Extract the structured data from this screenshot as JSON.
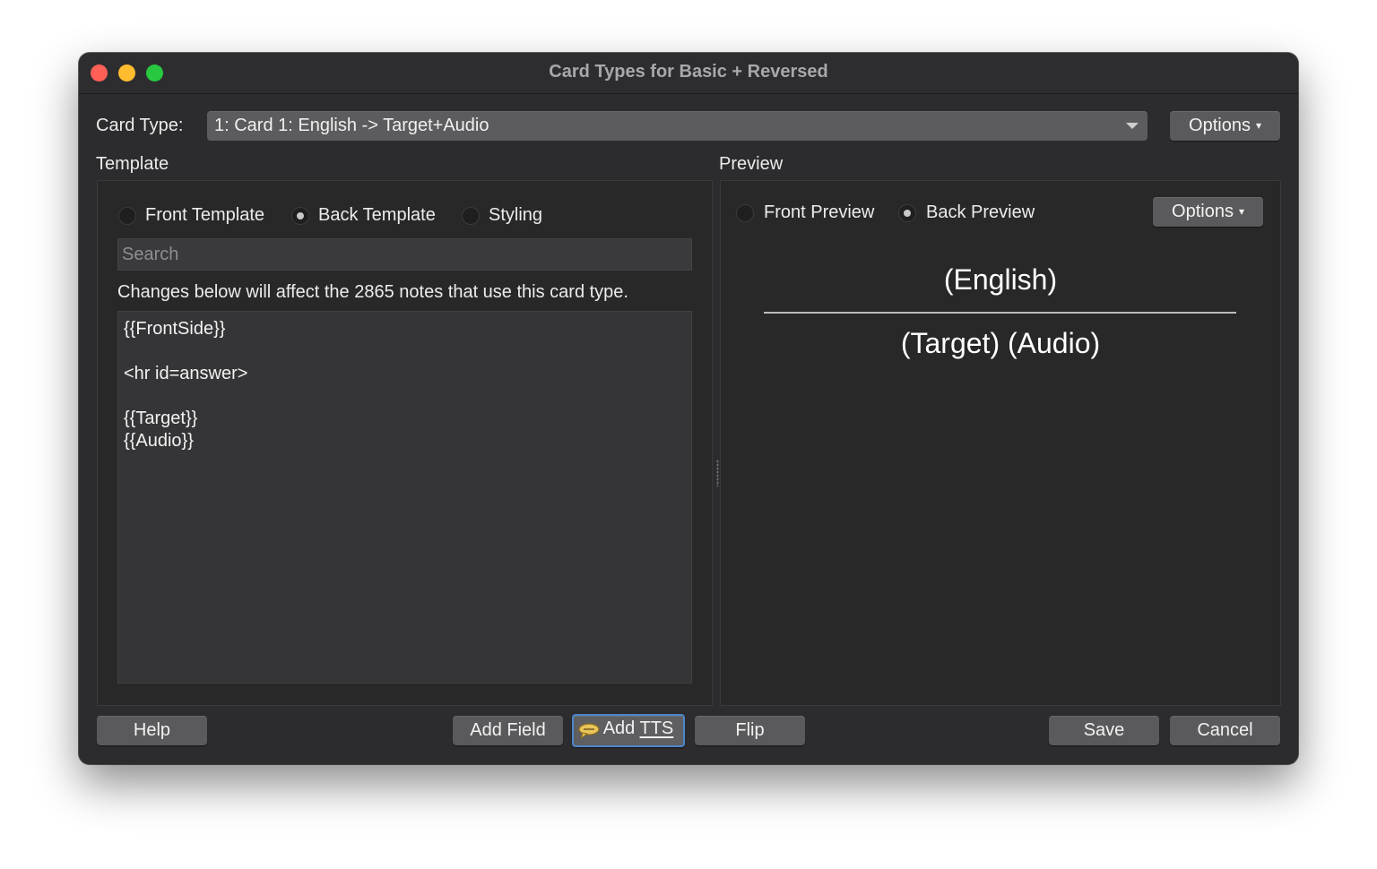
{
  "window": {
    "title": "Card Types for Basic + Reversed"
  },
  "card_type": {
    "label": "Card Type:",
    "selected": "1: Card 1: English -> Target+Audio",
    "options_button": "Options"
  },
  "template": {
    "section_label": "Template",
    "radios": [
      {
        "label": "Front Template",
        "checked": false
      },
      {
        "label": "Back Template",
        "checked": true
      },
      {
        "label": "Styling",
        "checked": false
      }
    ],
    "search_placeholder": "Search",
    "notice": "Changes below will affect the 2865 notes that use this card type.",
    "editor_lines": [
      "{{FrontSide}}",
      "",
      "<hr id=answer>",
      "",
      "{{Target}}",
      "{{Audio}}"
    ]
  },
  "preview": {
    "section_label": "Preview",
    "radios": [
      {
        "label": "Front Preview",
        "checked": false
      },
      {
        "label": "Back Preview",
        "checked": true
      }
    ],
    "options_button": "Options",
    "front_text": "(English)",
    "back_text": "(Target) (Audio)"
  },
  "buttons": {
    "help": "Help",
    "add_field": "Add Field",
    "add_tts_prefix": "Add ",
    "add_tts_accel": "TTS",
    "flip": "Flip",
    "save": "Save",
    "cancel": "Cancel"
  }
}
